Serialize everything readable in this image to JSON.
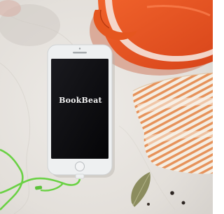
{
  "photo": {
    "app_logo_text": "BookBeat",
    "subjects": {
      "phone": "smartphone-image",
      "pot": "orange-cast-iron-pot-image",
      "towel": "striped-kitchen-towel-image",
      "cable": "green-earphone-cable-image",
      "leaf": "bay-leaf-image"
    },
    "colors": {
      "counter": "#e6e3de",
      "phone_body": "#eef0f1",
      "phone_screen": "#0d0d10",
      "pot": "#e8511c",
      "towel_stripe": "#e79a63",
      "towel_base": "#f4eee4",
      "cable": "#6fd24a",
      "leaf": "#8a8b5f"
    }
  }
}
